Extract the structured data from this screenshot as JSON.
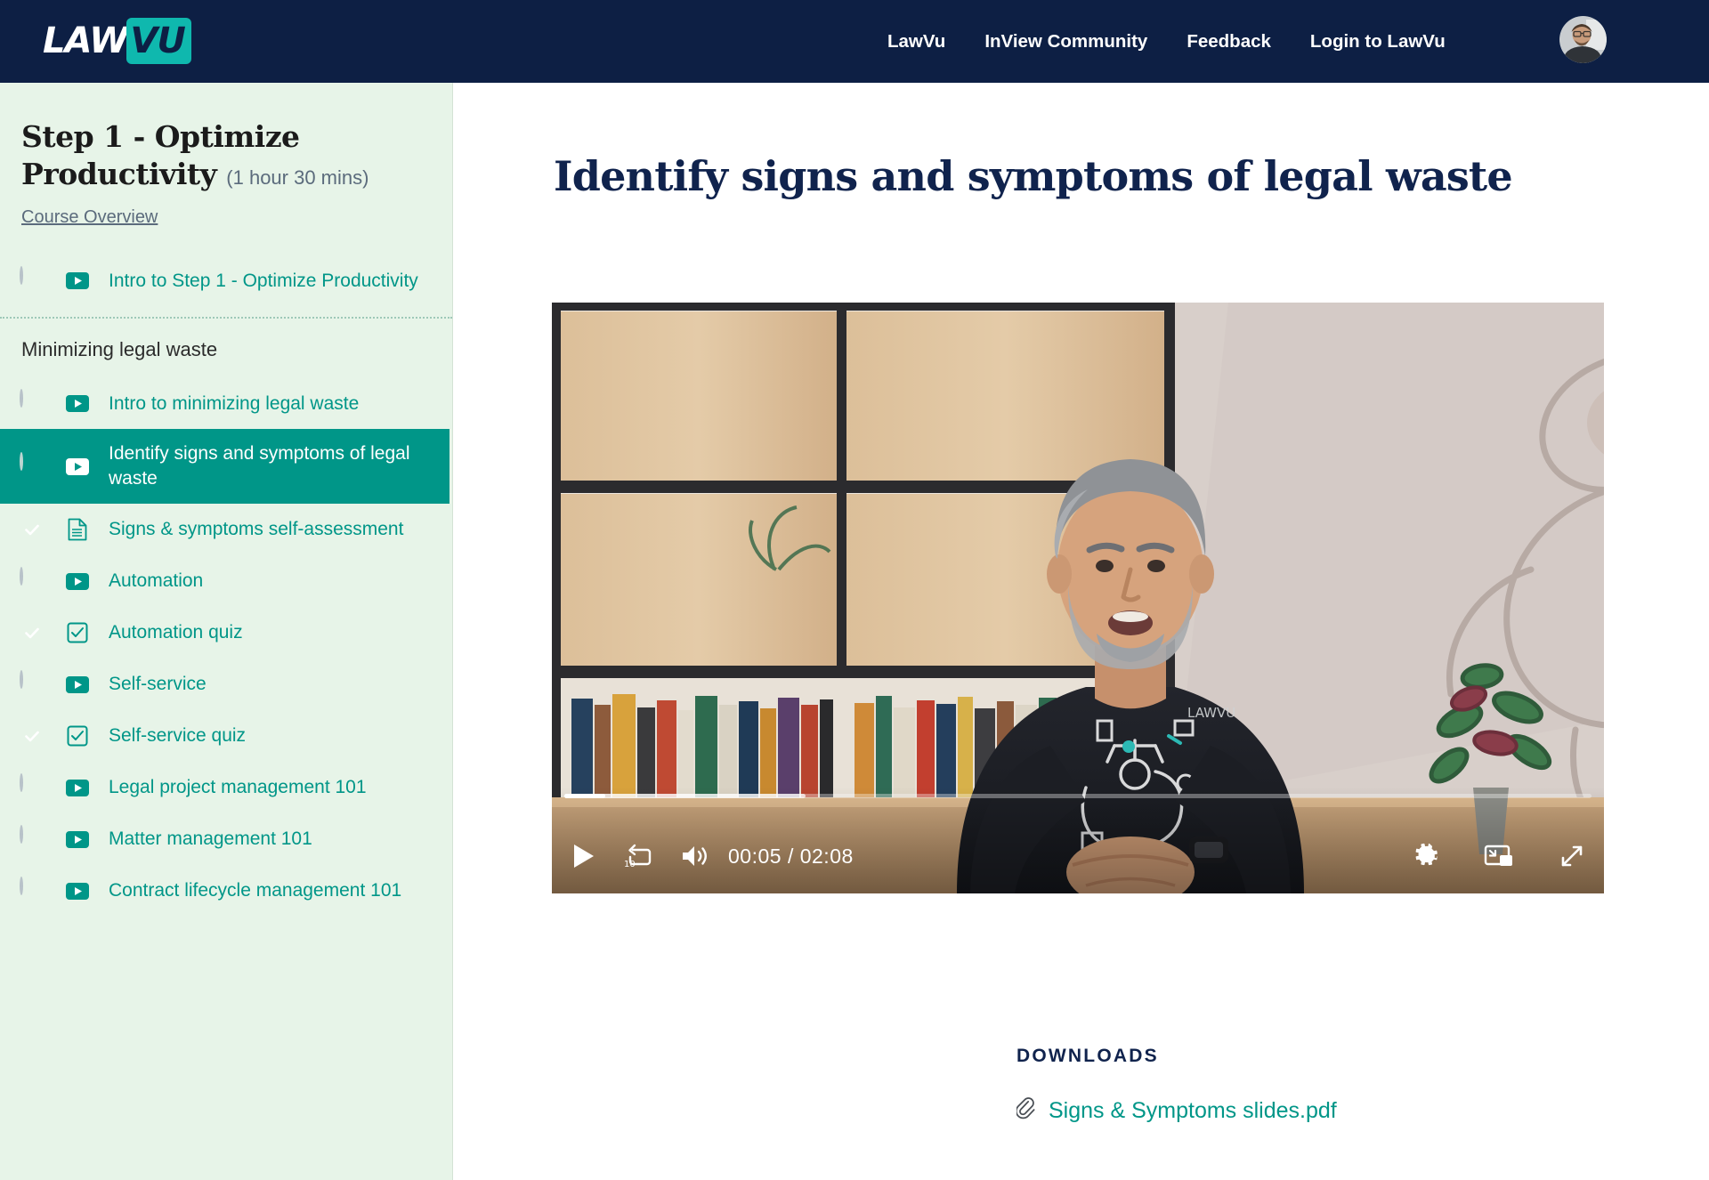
{
  "brand": {
    "logo_text_primary": "LAW",
    "logo_text_secondary": "VU",
    "accent_teal": "#009688",
    "logo_teal": "#0fb8ae",
    "navy": "#0d1f44",
    "sidebar_bg": "#e7f4e8"
  },
  "topnav": {
    "links": [
      {
        "label": "LawVu"
      },
      {
        "label": "InView Community"
      },
      {
        "label": "Feedback"
      },
      {
        "label": "Login to LawVu"
      }
    ],
    "avatar_icon": "user-avatar"
  },
  "sidebar": {
    "course_title": "Step 1 - Optimize Productivity",
    "course_duration": "(1 hour 30 mins)",
    "overview_link": "Course Overview",
    "section_heading": "Minimizing legal waste",
    "lessons_top": [
      {
        "label": "Intro to Step 1 - Optimize Productivity",
        "kind": "video",
        "kind_icon": "video-play-icon",
        "status": "incomplete",
        "active": false
      }
    ],
    "lessons": [
      {
        "label": "Intro to minimizing legal waste",
        "kind": "video",
        "kind_icon": "video-play-icon",
        "status": "incomplete",
        "active": false
      },
      {
        "label": "Identify signs and symptoms of legal waste",
        "kind": "video",
        "kind_icon": "video-play-icon",
        "status": "incomplete",
        "active": true
      },
      {
        "label": "Signs & symptoms self-assessment",
        "kind": "document",
        "kind_icon": "document-icon",
        "status": "complete",
        "active": false
      },
      {
        "label": "Automation",
        "kind": "video",
        "kind_icon": "video-play-icon",
        "status": "incomplete",
        "active": false
      },
      {
        "label": "Automation quiz",
        "kind": "quiz",
        "kind_icon": "quiz-checkbox-icon",
        "status": "complete",
        "active": false
      },
      {
        "label": "Self-service",
        "kind": "video",
        "kind_icon": "video-play-icon",
        "status": "incomplete",
        "active": false
      },
      {
        "label": "Self-service quiz",
        "kind": "quiz",
        "kind_icon": "quiz-checkbox-icon",
        "status": "complete",
        "active": false
      },
      {
        "label": "Legal project management 101",
        "kind": "video",
        "kind_icon": "video-play-icon",
        "status": "incomplete",
        "active": false
      },
      {
        "label": "Matter management 101",
        "kind": "video",
        "kind_icon": "video-play-icon",
        "status": "incomplete",
        "active": false
      },
      {
        "label": "Contract lifecycle management 101",
        "kind": "video",
        "kind_icon": "video-play-icon",
        "status": "incomplete",
        "active": false
      }
    ]
  },
  "main": {
    "lesson_title": "Identify signs and symptoms of legal waste",
    "video": {
      "current_time": "00:05",
      "separator": "/",
      "duration": "02:08",
      "time_display": "00:05  /  02:08",
      "progress_percent": 4,
      "buffered_percent": 23.5,
      "controls": {
        "play": "play-icon",
        "rewind": "rewind-10-icon",
        "rewind_label": "10",
        "volume": "volume-icon",
        "settings": "gear-icon",
        "pip": "picture-in-picture-icon",
        "fullscreen": "fullscreen-icon"
      }
    },
    "downloads": {
      "heading": "DOWNLOADS",
      "items": [
        {
          "name": "Signs & Symptoms slides.pdf",
          "icon": "paperclip-icon"
        }
      ]
    }
  }
}
